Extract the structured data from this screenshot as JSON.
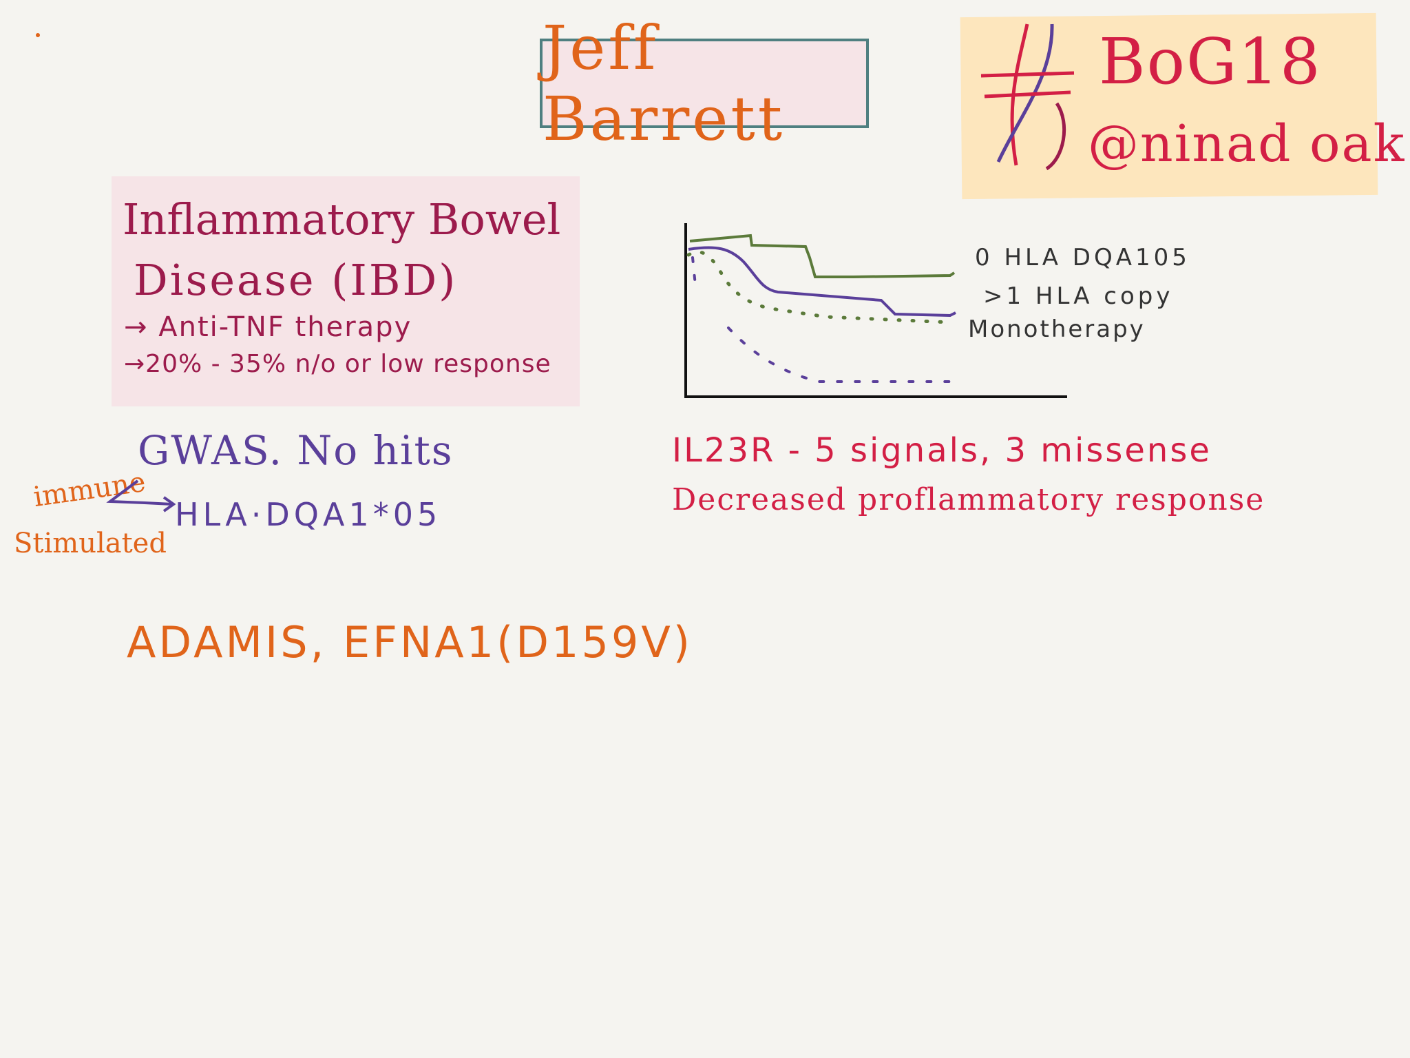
{
  "title": {
    "speaker": "Jeff Barrett"
  },
  "tag": {
    "hashtag": "BoG18",
    "handle": "@ninad oak"
  },
  "ibd": {
    "title_line1": "Inflammatory Bowel",
    "title_line2": "Disease (IBD)",
    "line1": "→ Anti-TNF therapy",
    "line2": "→20% - 35% n/o or low response"
  },
  "gwas": {
    "headline": "GWAS. No hits",
    "gene": "HLA·DQA1*05",
    "note_line1": "immune",
    "note_line2": "Stimulated"
  },
  "genes": {
    "line": "ADAMIS, EFNA1(D159V)"
  },
  "chart_legend": {
    "label1": "0 HLA DQA105",
    "label2": ">1 HLA copy",
    "label3": "Monotherapy"
  },
  "il23r": {
    "line1": "IL23R - 5 signals, 3 missense",
    "line2": "Decreased proflammatory response"
  },
  "colors": {
    "orange": "#e0641a",
    "crimson": "#d31f45",
    "plum": "#9c1b4c",
    "purple": "#5a3f9a",
    "green": "#5b7a3a",
    "pink_box": "#f6e4e7",
    "tag_box": "#fde6bd",
    "title_border": "#4f7f80"
  },
  "icons": [
    "dot-mark",
    "hash-icon",
    "arrow-split-icon"
  ]
}
